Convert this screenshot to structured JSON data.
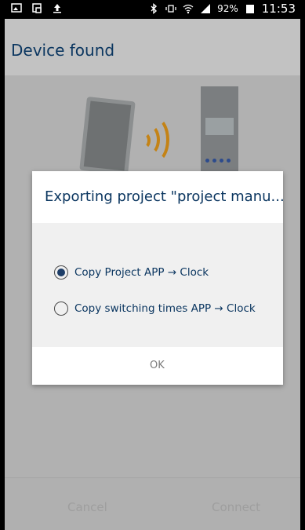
{
  "status_bar": {
    "left_icons": [
      "image-icon",
      "cast-icon",
      "upload-icon"
    ],
    "right_icons": [
      "bluetooth-icon",
      "vibrate-icon",
      "wifi-icon",
      "signal-icon"
    ],
    "battery": "92%",
    "time": "11:53"
  },
  "appbar": {
    "title": "Device found"
  },
  "dialog": {
    "title": "Exporting project \"project manu...",
    "options": [
      {
        "label": "Copy Project APP → Clock",
        "selected": true
      },
      {
        "label": "Copy switching times APP → Clock",
        "selected": false
      }
    ],
    "ok_label": "OK"
  },
  "bottom": {
    "cancel": "Cancel",
    "connect": "Connect"
  },
  "colors": {
    "accent": "#0b3660",
    "wave": "#c48316"
  }
}
